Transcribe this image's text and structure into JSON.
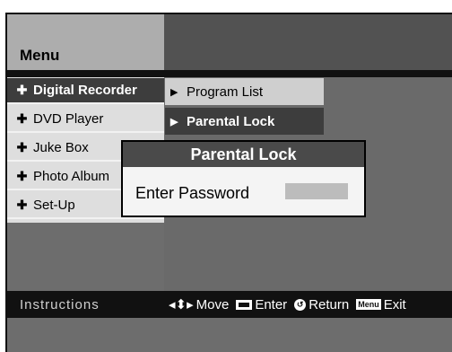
{
  "header": {
    "title": "Menu"
  },
  "menu": {
    "items": [
      {
        "label": "Digital Recorder",
        "active": true
      },
      {
        "label": "DVD Player",
        "active": false
      },
      {
        "label": "Juke Box",
        "active": false
      },
      {
        "label": "Photo Album",
        "active": false
      },
      {
        "label": "Set-Up",
        "active": false
      }
    ]
  },
  "submenu": {
    "items": [
      {
        "label": "Program List",
        "active": false
      },
      {
        "label": "Parental Lock",
        "active": true
      }
    ]
  },
  "popup": {
    "title": "Parental Lock",
    "label": "Enter Password",
    "password_value": ""
  },
  "instructions": {
    "label": "Instructions",
    "move_label": "Move",
    "enter_label": "Enter",
    "return_label": "Return",
    "menu_key": "Menu",
    "exit_label": "Exit",
    "move_icon": "◂⬍▸",
    "return_icon": "↺"
  },
  "colors": {
    "active_bg": "#3d3d3d",
    "menu_bg": "#dedede",
    "panel_bg": "#6a6a6a",
    "bar_bg": "#111111"
  }
}
